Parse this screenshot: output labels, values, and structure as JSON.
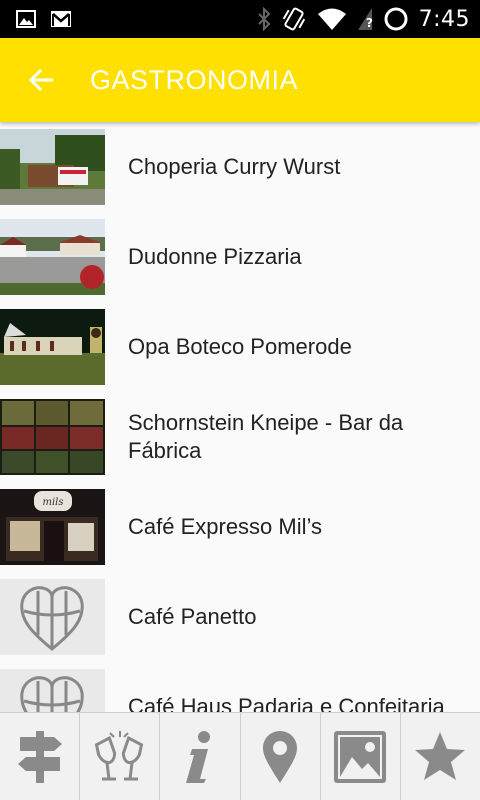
{
  "status_bar": {
    "time": "7:45",
    "icons": [
      "image-icon",
      "gmail-icon",
      "bluetooth-icon",
      "vibrate-icon",
      "wifi-icon",
      "no-sim-icon",
      "battery-icon"
    ]
  },
  "app_bar": {
    "title": "GASTRONOMIA",
    "back_icon": "arrow-back-icon",
    "background": "#ffe000",
    "title_color": "#ffffff"
  },
  "list": {
    "items": [
      {
        "label": "Choperia Curry Wurst",
        "thumb": "photo"
      },
      {
        "label": "Dudonne Pizzaria",
        "thumb": "photo"
      },
      {
        "label": "Opa Boteco Pomerode",
        "thumb": "photo"
      },
      {
        "label": "Schornstein Kneipe - Bar da Fábrica",
        "thumb": "photo"
      },
      {
        "label": "Café Expresso Mil’s",
        "thumb": "photo"
      },
      {
        "label": "Café Panetto",
        "thumb": "heart-placeholder-icon"
      },
      {
        "label": "Café Haus Padaria e Confeitaria",
        "thumb": "heart-placeholder-icon"
      }
    ]
  },
  "tab_bar": {
    "tabs": [
      {
        "icon": "signpost-icon"
      },
      {
        "icon": "wine-glasses-icon"
      },
      {
        "icon": "info-icon"
      },
      {
        "icon": "map-pin-icon"
      },
      {
        "icon": "gallery-icon"
      },
      {
        "icon": "star-icon"
      }
    ],
    "icon_color": "#8a8a8a"
  }
}
